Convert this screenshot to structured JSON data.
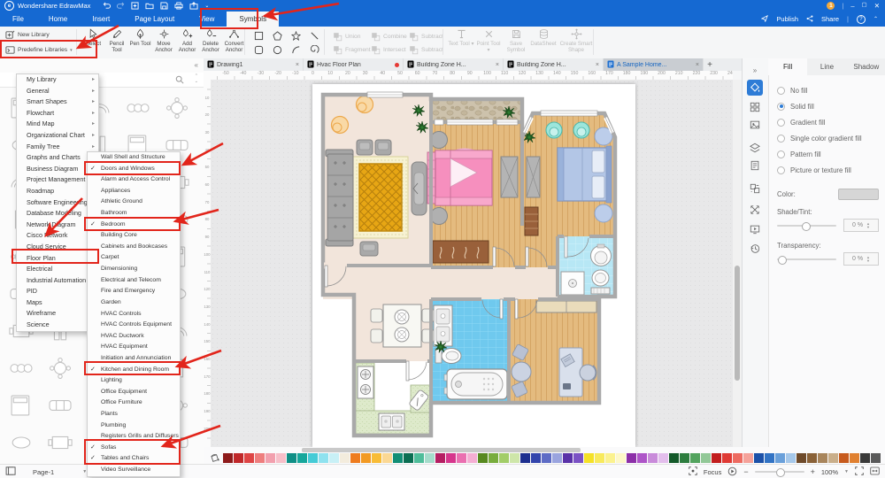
{
  "app": {
    "title": "Wondershare EdrawMax",
    "badge": "1"
  },
  "menubar": {
    "items": [
      "File",
      "Home",
      "Insert",
      "Page Layout",
      "View",
      "Symbols"
    ],
    "active_index": 5,
    "publish": "Publish",
    "share": "Share"
  },
  "ribbon": {
    "new_library": "New Library",
    "predefine_libraries": "Predefine Libraries",
    "draw_tools": [
      "Select",
      "Pencil Tool",
      "Pen Tool",
      "Move Anchor",
      "Add Anchor",
      "Delete Anchor",
      "Convert Anchor"
    ],
    "boolean_ops_row1": [
      "Union",
      "Combine",
      "Subtract"
    ],
    "boolean_ops_row2": [
      "Fragment",
      "Intersect",
      "Subtract"
    ],
    "symbol_tools": [
      "Text Tool",
      "Point Tool",
      "Save Symbol",
      "DataSheet",
      "Create Smart Shape"
    ]
  },
  "tabs": [
    {
      "label": "Drawing1",
      "close": true,
      "active": false,
      "dirty": false
    },
    {
      "label": "Hvac Floor Plan",
      "close": false,
      "active": false,
      "dirty": true
    },
    {
      "label": "Building Zone H...",
      "close": true,
      "active": false,
      "dirty": false
    },
    {
      "label": "Building Zone H...",
      "close": true,
      "active": false,
      "dirty": false
    },
    {
      "label": "A Sample Home...",
      "close": true,
      "active": true,
      "dirty": false
    }
  ],
  "library_menu": {
    "items": [
      "My Library",
      "General",
      "Smart Shapes",
      "Flowchart",
      "Mind Map",
      "Organizational Chart",
      "Family Tree",
      "Graphs and Charts",
      "Business Diagram",
      "Project Management",
      "Roadmap",
      "Software Engineering",
      "Database Modeling",
      "Network Diagram",
      "Cisco Network",
      "Cloud Service",
      "Floor Plan",
      "Electrical",
      "Industrial Automation",
      "PID",
      "Maps",
      "Wireframe",
      "Science"
    ],
    "highlighted": "Floor Plan"
  },
  "floorplan_menu": [
    {
      "label": "Wall Shell and Structure",
      "checked": false
    },
    {
      "label": "Doors and Windows",
      "checked": true
    },
    {
      "label": "Alarm and Access Control",
      "checked": false
    },
    {
      "label": "Appliances",
      "checked": false
    },
    {
      "label": "Athletic Ground",
      "checked": false
    },
    {
      "label": "Bathroom",
      "checked": false
    },
    {
      "label": "Bedroom",
      "checked": true
    },
    {
      "label": "Building Core",
      "checked": false
    },
    {
      "label": "Cabinets and Bookcases",
      "checked": false
    },
    {
      "label": "Carpet",
      "checked": false
    },
    {
      "label": "Dimensioning",
      "checked": false
    },
    {
      "label": "Electrical and Telecom",
      "checked": false
    },
    {
      "label": "Fire and Emergency",
      "checked": false
    },
    {
      "label": "Garden",
      "checked": false
    },
    {
      "label": "HVAC Controls",
      "checked": false
    },
    {
      "label": "HVAC Controls Equipment",
      "checked": false
    },
    {
      "label": "HVAC Ductwork",
      "checked": false
    },
    {
      "label": "HVAC Equipment",
      "checked": false
    },
    {
      "label": "Initiation and Annunciation",
      "checked": false
    },
    {
      "label": "Kitchen and Dining Room",
      "checked": true
    },
    {
      "label": "Lighting",
      "checked": false
    },
    {
      "label": "Office Equipment",
      "checked": false
    },
    {
      "label": "Office Furniture",
      "checked": false
    },
    {
      "label": "Plants",
      "checked": false
    },
    {
      "label": "Plumbing",
      "checked": false
    },
    {
      "label": "Registers Grills and Diffusers",
      "checked": false
    },
    {
      "label": "Sofas",
      "checked": true
    },
    {
      "label": "Tables and Chairs",
      "checked": true
    },
    {
      "label": "Video Surveillance",
      "checked": false
    }
  ],
  "right_panel": {
    "tabs": [
      "Fill",
      "Line",
      "Shadow"
    ],
    "active_tab": "Fill",
    "fill_options": [
      {
        "label": "No fill",
        "selected": false
      },
      {
        "label": "Solid fill",
        "selected": true
      },
      {
        "label": "Gradient fill",
        "selected": false
      },
      {
        "label": "Single color gradient fill",
        "selected": false
      },
      {
        "label": "Pattern fill",
        "selected": false
      },
      {
        "label": "Picture or texture fill",
        "selected": false
      }
    ],
    "color_label": "Color:",
    "shade_label": "Shade/Tint:",
    "shade_value": "0 %",
    "transparency_label": "Transparency:",
    "transparency_value": "0 %"
  },
  "rulers": {
    "horizontal": [
      -50,
      -40,
      -30,
      -20,
      -10,
      0,
      10,
      20,
      30,
      40,
      50,
      60,
      70,
      80,
      90,
      100,
      110,
      120,
      130,
      140,
      150,
      160,
      170,
      180,
      190,
      200,
      210,
      220,
      230,
      240
    ],
    "vertical": [
      10,
      20,
      30,
      40,
      50,
      60,
      70,
      80,
      90,
      100,
      110,
      120,
      130,
      140,
      150,
      160,
      170,
      180,
      190,
      200
    ]
  },
  "statusbar": {
    "page": "Page-1",
    "focus_label": "Focus",
    "zoom": "100%"
  },
  "library_panel": {
    "shape_types": [
      "bed",
      "sofa",
      "arc",
      "rings",
      "round-table",
      "oval-table",
      "rect-table",
      "columns"
    ],
    "grid_rows": 10,
    "grid_cols": 5
  },
  "palette": [
    "#8E1B1B",
    "#C0282A",
    "#DE4545",
    "#EE7E7E",
    "#F2A0AE",
    "#F7BFC9",
    "#0F8F86",
    "#16A79B",
    "#45CBD6",
    "#8FE2EF",
    "#C8F0F6",
    "#F3ECDD",
    "#EE7C1F",
    "#F29A23",
    "#F8BC37",
    "#FBD894",
    "#128F76",
    "#0A6E52",
    "#4FBD9A",
    "#A5DCCB",
    "#B51E62",
    "#D6368C",
    "#EA6FB0",
    "#F5AED3",
    "#57891F",
    "#78AC3C",
    "#A2CD68",
    "#CEE6A9",
    "#1D2F8F",
    "#3345AC",
    "#5E6CC5",
    "#9AA4DE",
    "#5A32A8",
    "#7B52C4",
    "#F5E127",
    "#F8EA5C",
    "#FBF28F",
    "#FDF8C8",
    "#8C2FA8",
    "#AE55C8",
    "#C98BDA",
    "#E3BEEC",
    "#145A2A",
    "#2D7D3F",
    "#53A35E",
    "#92C897",
    "#C21E1E",
    "#DF3A35",
    "#ED6B61",
    "#F5A29A",
    "#1C51A8",
    "#3273C4",
    "#6AA0DA",
    "#A6C8EA",
    "#6E4A2A",
    "#8A6238",
    "#A8855C",
    "#C9AE8A",
    "#C75B1E",
    "#E08030",
    "#3A3A3A",
    "#5A5A5A"
  ],
  "colors": {
    "titlebar": "#1569D2",
    "accent": "#2E7CD6",
    "annotation": "#E2251B",
    "tab_active_text": "#1565C0"
  }
}
